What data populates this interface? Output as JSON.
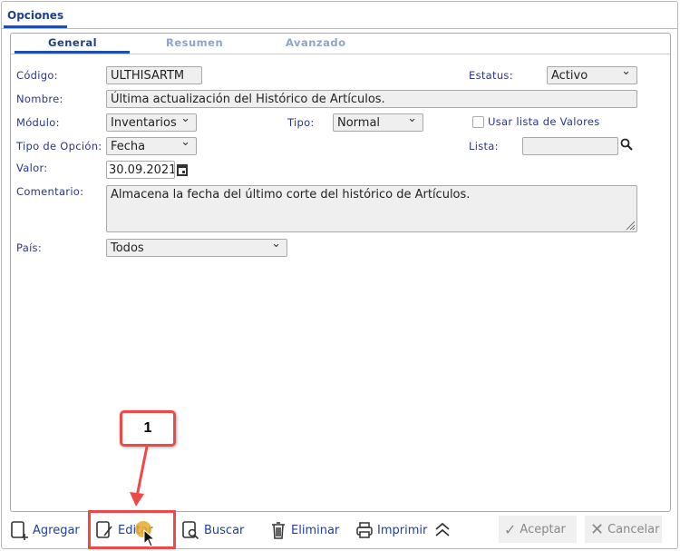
{
  "window": {
    "tab": "Opciones"
  },
  "subtabs": [
    "General",
    "Resumen",
    "Avanzado"
  ],
  "form": {
    "codigo": {
      "label": "Código:",
      "value": "ULTHISARTM"
    },
    "estatus": {
      "label": "Estatus:",
      "value": "Activo"
    },
    "nombre": {
      "label": "Nombre:",
      "value": "Última actualización del Histórico de Artículos."
    },
    "modulo": {
      "label": "Módulo:",
      "value": "Inventarios"
    },
    "tipo": {
      "label": "Tipo:",
      "value": "Normal"
    },
    "usar_lista": {
      "label": "Usar lista de Valores",
      "checked": false
    },
    "tipo_opcion": {
      "label": "Tipo de Opción:",
      "value": "Fecha"
    },
    "lista": {
      "label": "Lista:",
      "value": ""
    },
    "valor": {
      "label": "Valor:",
      "value": "30.09.2021"
    },
    "comentario": {
      "label": "Comentario:",
      "value": "Almacena la fecha del último corte del histórico de Artículos."
    },
    "pais": {
      "label": "País:",
      "value": "Todos"
    }
  },
  "toolbar": {
    "agregar": "Agregar",
    "editar": "Editar",
    "buscar": "Buscar",
    "eliminar": "Eliminar",
    "imprimir": "Imprimir",
    "aceptar": "Aceptar",
    "cancelar": "Cancelar"
  },
  "annotation": {
    "step": "1",
    "color": "#f04848"
  }
}
